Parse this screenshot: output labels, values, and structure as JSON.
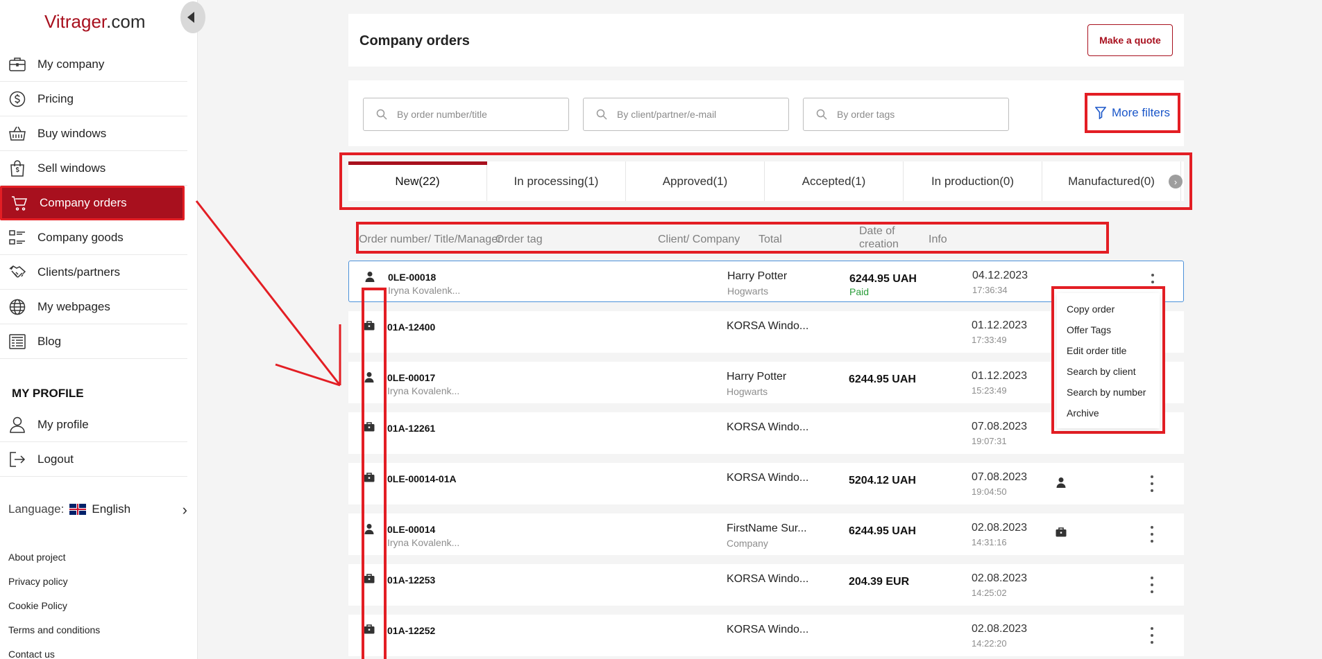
{
  "brand": {
    "name_red": "Vitrager",
    "name_rest": ".com"
  },
  "sidebar": {
    "items": [
      {
        "label": "My company",
        "icon": "briefcase-icon"
      },
      {
        "label": "Pricing",
        "icon": "dollar-circle-icon"
      },
      {
        "label": "Buy windows",
        "icon": "basket-icon"
      },
      {
        "label": "Sell windows",
        "icon": "shopping-bag-icon"
      },
      {
        "label": "Company orders",
        "icon": "cart-icon"
      },
      {
        "label": "Company goods",
        "icon": "list-icon"
      },
      {
        "label": "Clients/partners",
        "icon": "handshake-icon"
      },
      {
        "label": "My webpages",
        "icon": "globe-icon"
      },
      {
        "label": "Blog",
        "icon": "newspaper-icon"
      }
    ],
    "profile_title": "MY PROFILE",
    "profile_items": [
      {
        "label": "My profile",
        "icon": "user-icon"
      },
      {
        "label": "Logout",
        "icon": "logout-icon"
      }
    ],
    "language_label": "Language:",
    "language_value": "English",
    "footer_links": [
      "About project",
      "Privacy policy",
      "Cookie Policy",
      "Terms and conditions",
      "Contact us"
    ]
  },
  "header": {
    "title": "Company orders",
    "quote_button": "Make a quote"
  },
  "filters": {
    "placeholders": [
      "By order number/title",
      "By client/partner/e-mail",
      "By order tags"
    ],
    "more_filters": "More filters"
  },
  "tabs": [
    {
      "label": "New",
      "count": "(22)"
    },
    {
      "label": "In processing",
      "count": "(1)"
    },
    {
      "label": "Approved",
      "count": "(1)"
    },
    {
      "label": "Accepted",
      "count": "(1)"
    },
    {
      "label": "In production",
      "count": "(0)"
    },
    {
      "label": "Manufactured",
      "count": "(0)"
    }
  ],
  "columns": {
    "order": "Order number/ Title/Manager",
    "tag": "Order tag",
    "client": "Client/ Company",
    "total": "Total",
    "date_line1": "Date of",
    "date_line2": "creation",
    "info": "Info"
  },
  "orders": [
    {
      "type": "user",
      "number": "0LE-00018",
      "manager": "Iryna Kovalenk...",
      "client": "Harry Potter",
      "company": "Hogwarts",
      "total": "6244.95 UAH",
      "status": "Paid",
      "date": "04.12.2023",
      "time": "17:36:34",
      "info": ""
    },
    {
      "type": "briefcase",
      "number": "01A-12400",
      "manager": "",
      "client": "KORSA Windo...",
      "company": "",
      "total": "",
      "status": "",
      "date": "01.12.2023",
      "time": "17:33:49",
      "info": ""
    },
    {
      "type": "user",
      "number": "0LE-00017",
      "manager": "Iryna Kovalenk...",
      "client": "Harry Potter",
      "company": "Hogwarts",
      "total": "6244.95 UAH",
      "status": "",
      "date": "01.12.2023",
      "time": "15:23:49",
      "info": ""
    },
    {
      "type": "briefcase",
      "number": "01A-12261",
      "manager": "",
      "client": "KORSA Windo...",
      "company": "",
      "total": "",
      "status": "",
      "date": "07.08.2023",
      "time": "19:07:31",
      "info": ""
    },
    {
      "type": "briefcase",
      "number": "0LE-00014-01A",
      "manager": "",
      "client": "KORSA Windo...",
      "company": "",
      "total": "5204.12 UAH",
      "status": "",
      "date": "07.08.2023",
      "time": "19:04:50",
      "info": "user"
    },
    {
      "type": "user",
      "number": "0LE-00014",
      "manager": "Iryna Kovalenk...",
      "client": "FirstName Sur...",
      "company": "Company",
      "total": "6244.95 UAH",
      "status": "",
      "date": "02.08.2023",
      "time": "14:31:16",
      "info": "briefcase"
    },
    {
      "type": "briefcase",
      "number": "01A-12253",
      "manager": "",
      "client": "KORSA Windo...",
      "company": "",
      "total": "204.39 EUR",
      "status": "",
      "date": "02.08.2023",
      "time": "14:25:02",
      "info": ""
    },
    {
      "type": "briefcase",
      "number": "01A-12252",
      "manager": "",
      "client": "KORSA Windo...",
      "company": "",
      "total": "",
      "status": "",
      "date": "02.08.2023",
      "time": "14:22:20",
      "info": ""
    }
  ],
  "context_menu": [
    "Copy order",
    "Offer Tags",
    "Edit order title",
    "Search by client",
    "Search by number",
    "Archive"
  ],
  "colors": {
    "brand_red": "#a8101e",
    "annotation_red": "#e31e24",
    "link_blue": "#1a56c9",
    "paid_green": "#2a9d3a"
  }
}
